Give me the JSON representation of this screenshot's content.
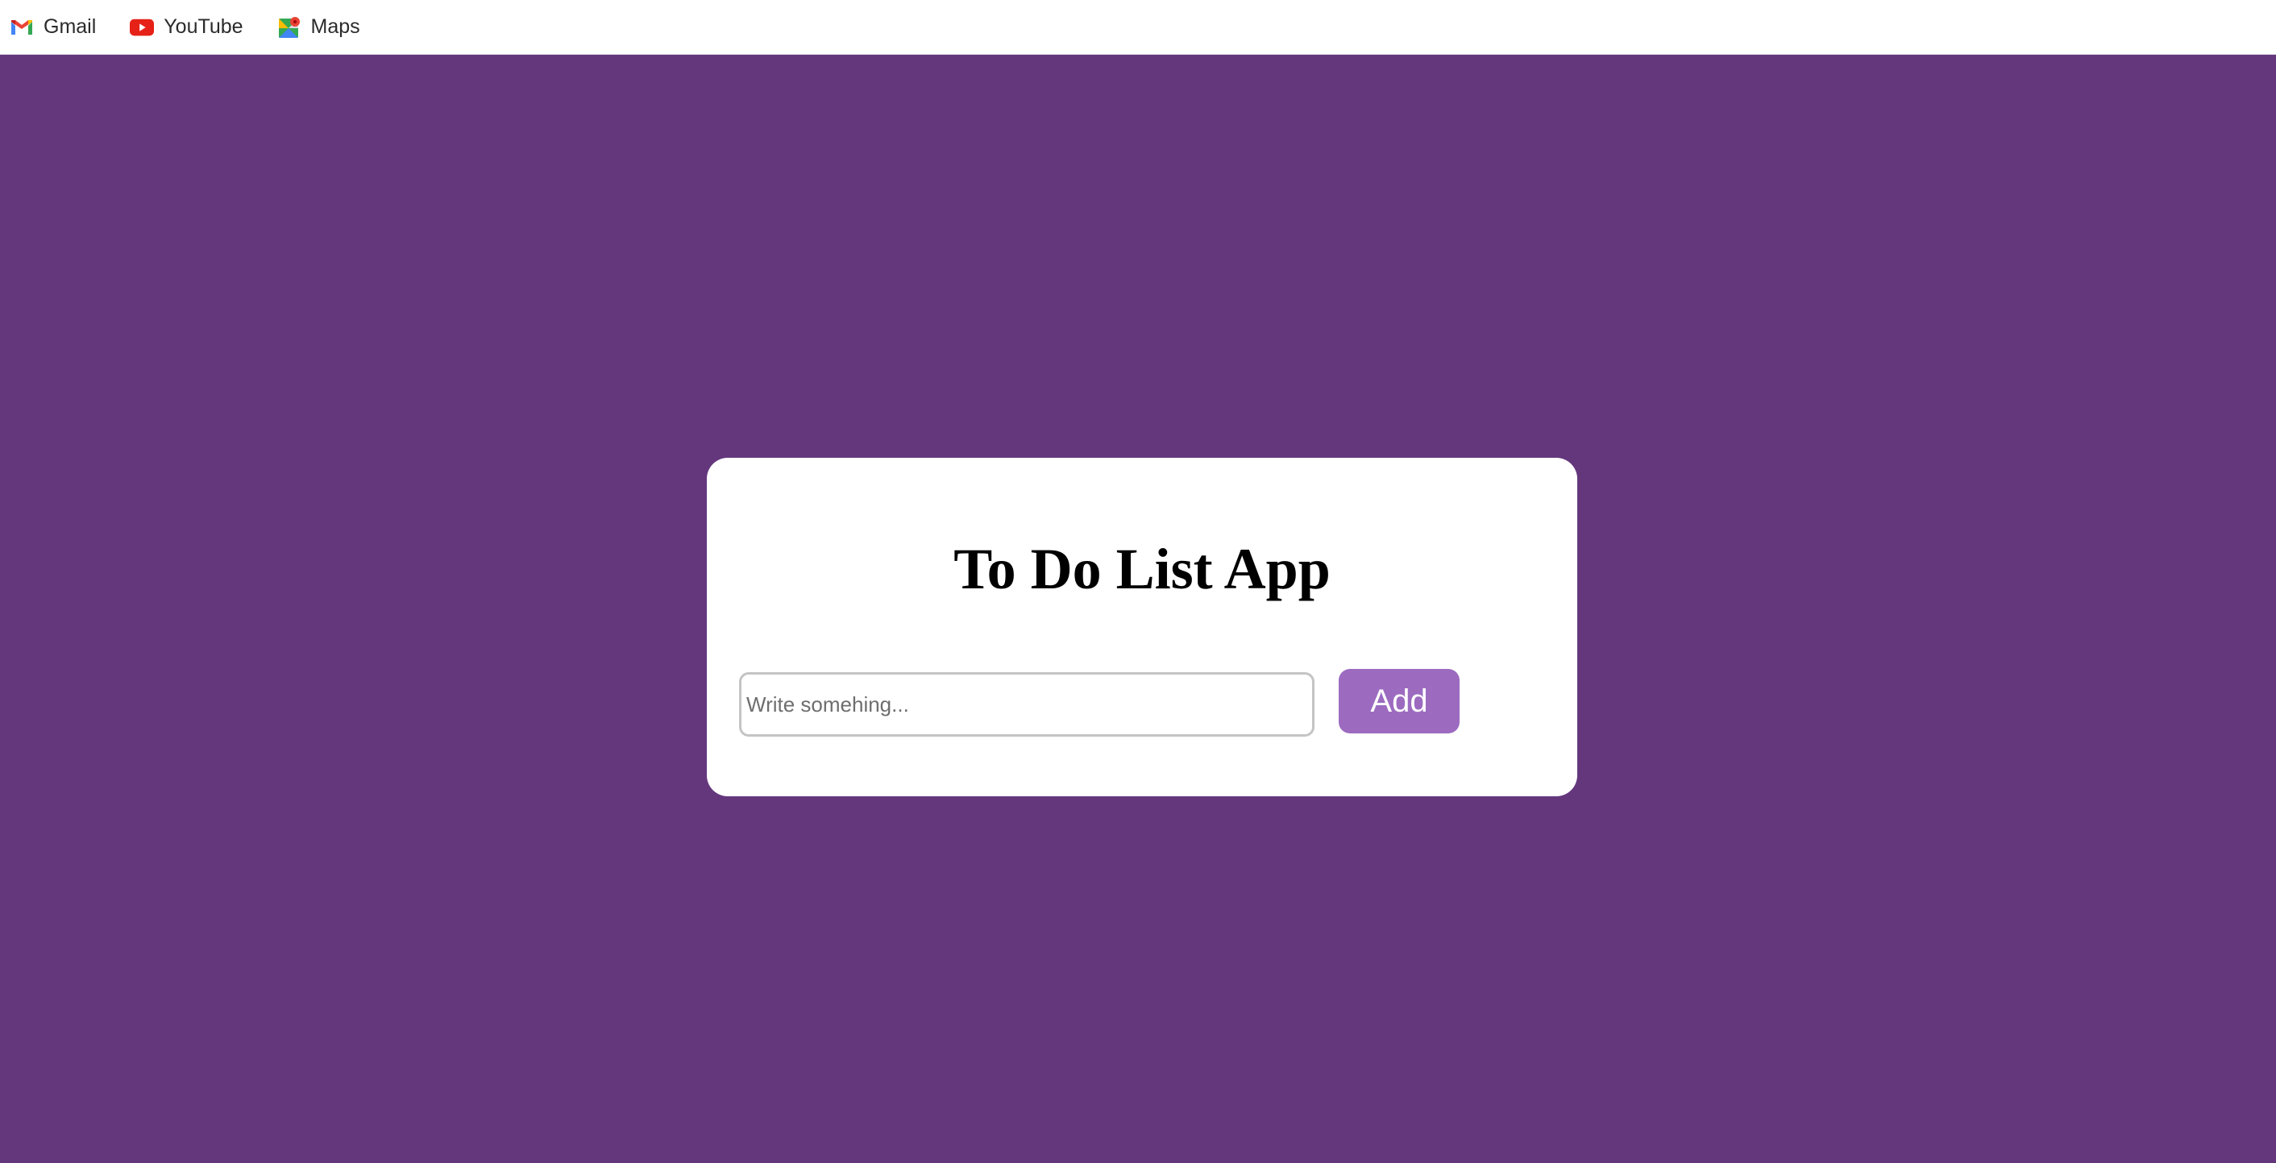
{
  "bookmarks": [
    {
      "label": "Gmail",
      "icon": "gmail-icon"
    },
    {
      "label": "YouTube",
      "icon": "youtube-icon"
    },
    {
      "label": "Maps",
      "icon": "maps-icon"
    }
  ],
  "app": {
    "title": "To Do List App",
    "input_placeholder": "Write somehing...",
    "input_value": "",
    "add_label": "Add"
  },
  "colors": {
    "background": "#64377d",
    "card": "#ffffff",
    "button": "#9c6bc0",
    "button_text": "#ffffff"
  }
}
